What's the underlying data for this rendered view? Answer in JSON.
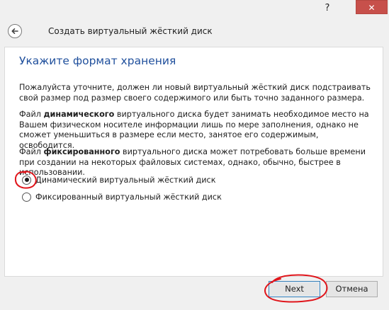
{
  "titlebar": {
    "help": "?",
    "close": "✕"
  },
  "header": {
    "title": "Создать виртуальный жёсткий диск",
    "back_icon": "arrow-left-icon"
  },
  "main": {
    "heading": "Укажите формат хранения",
    "paragraph1": "Пожалуйста уточните, должен ли новый виртуальный жёсткий диск подстраивать свой размер под размер своего содержимого или быть точно заданного размера.",
    "paragraph2": {
      "before": "Файл ",
      "bold": "динамического",
      "after": " виртуального диска будет занимать необходимое место на Вашем физическом носителе информации лишь по мере заполнения, однако не сможет уменьшиться в размере если место, занятое его содержимым, освободится."
    },
    "paragraph3": {
      "before": "Файл ",
      "bold": "фиксированного",
      "after": " виртуального диска может потребовать больше времени при создании на некоторых файловых системах, однако, обычно, быстрее в использовании."
    },
    "options": [
      {
        "label": "Динамический виртуальный жёсткий диск",
        "selected": true
      },
      {
        "label": "Фиксированный виртуальный жёсткий диск",
        "selected": false
      }
    ]
  },
  "footer": {
    "next_label": "Next",
    "cancel_label": "Отмена"
  },
  "colors": {
    "heading": "#1f4f9c",
    "close_button": "#c7504b",
    "annotation": "#e0151b"
  }
}
